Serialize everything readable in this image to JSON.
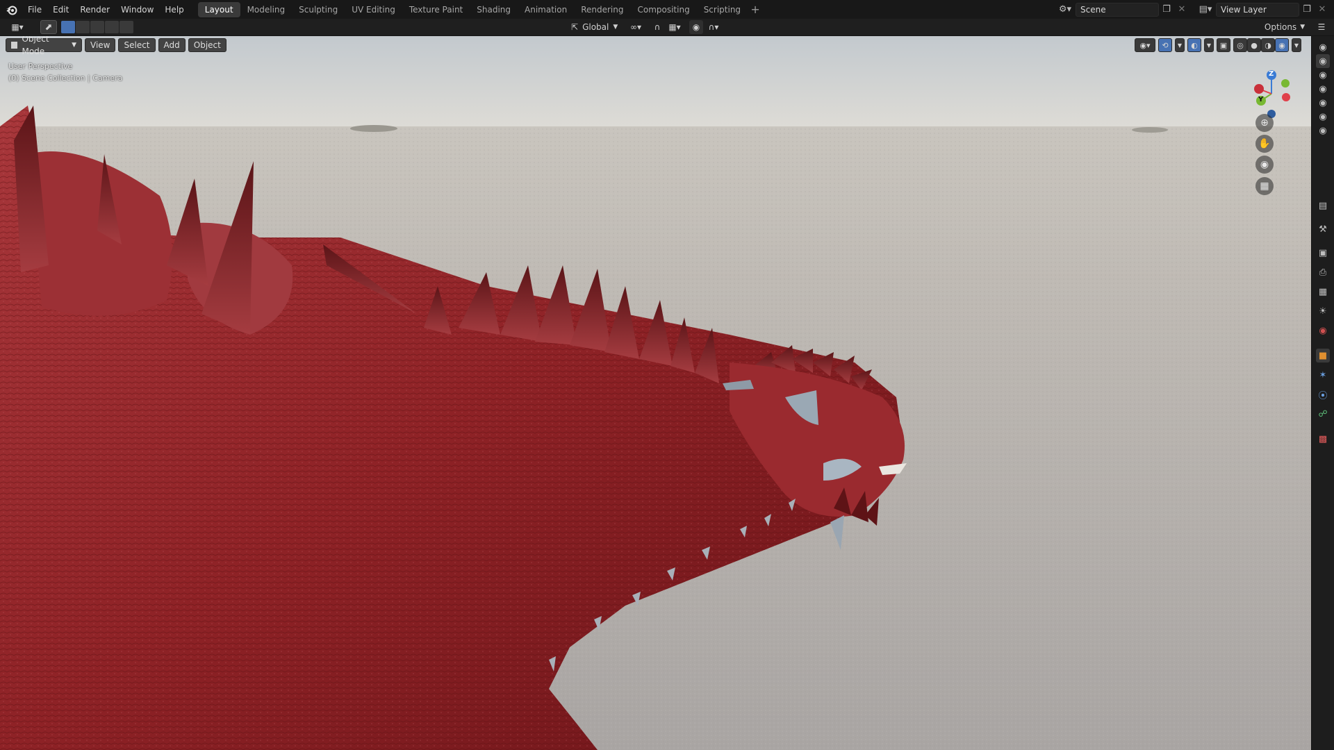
{
  "menu": [
    "File",
    "Edit",
    "Render",
    "Window",
    "Help"
  ],
  "workspaces": [
    {
      "label": "Layout",
      "active": true
    },
    {
      "label": "Modeling",
      "active": false
    },
    {
      "label": "Sculpting",
      "active": false
    },
    {
      "label": "UV Editing",
      "active": false
    },
    {
      "label": "Texture Paint",
      "active": false
    },
    {
      "label": "Shading",
      "active": false
    },
    {
      "label": "Animation",
      "active": false
    },
    {
      "label": "Rendering",
      "active": false
    },
    {
      "label": "Compositing",
      "active": false
    },
    {
      "label": "Scripting",
      "active": false
    }
  ],
  "workspace_add": "+",
  "scene": {
    "name": "Scene"
  },
  "view_layer": {
    "name": "View Layer"
  },
  "toolheader": {
    "orientation": "Global",
    "options_label": "Options"
  },
  "viewport": {
    "mode": "Object Mode",
    "menus": [
      "View",
      "Select",
      "Add",
      "Object"
    ],
    "overlay_line1": "User Perspective",
    "overlay_line2": "(0) Scene Collection | Camera"
  },
  "gizmo": {
    "z": "Z",
    "y": "Y"
  },
  "colors": {
    "accent": "#4772b3",
    "sky_top": "#c9cfd4",
    "ground": "#b0aba8",
    "dragon": "#8a1f23",
    "axis_x": "#e0404a",
    "axis_y": "#78b832",
    "axis_z": "#3a7bd5"
  }
}
